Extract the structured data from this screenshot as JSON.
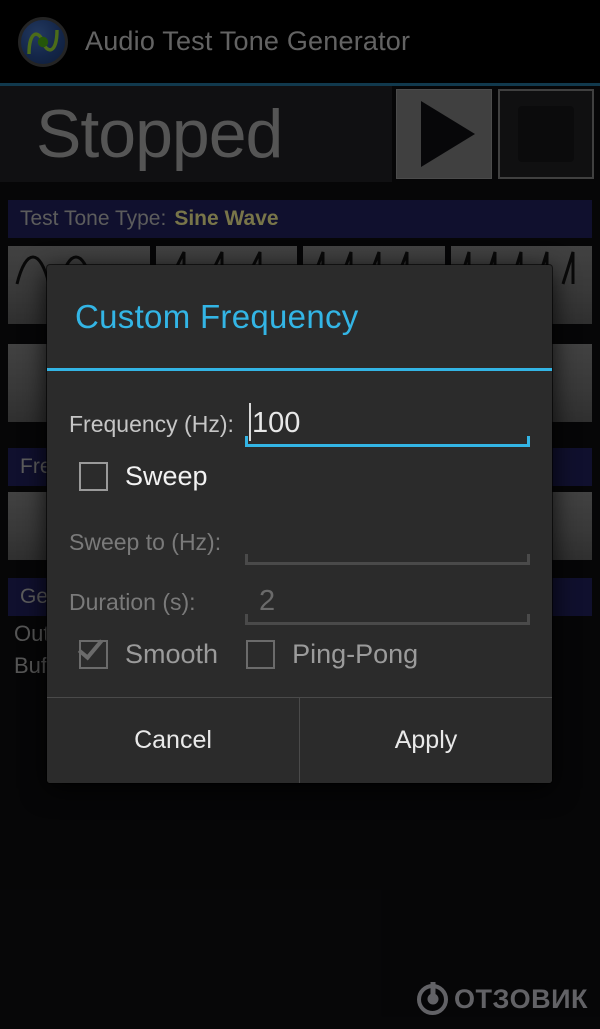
{
  "app": {
    "title": "Audio Test Tone Generator",
    "icon": "sine-wave-circle-icon",
    "accent_blue": "#33b5e5",
    "header_bar_blue": "#1c1c4e",
    "divider_blue": "#1d6080"
  },
  "transport": {
    "status": "Stopped",
    "play_icon": "play-icon",
    "stop_icon": "stop-icon"
  },
  "sections": {
    "tone_type": {
      "label": "Test Tone Type:",
      "value": "Sine Wave"
    },
    "frequency": {
      "label": "Frequency",
      "value": ""
    },
    "general": {
      "label": "General",
      "value": ""
    }
  },
  "general_text": "Output\nBuffer",
  "dialog": {
    "title": "Custom Frequency",
    "fields": [
      {
        "label": "Frequency (Hz):",
        "value": "100",
        "placeholder": "",
        "enabled": true,
        "focused": true
      },
      {
        "label": "Sweep to (Hz):",
        "value": "",
        "placeholder": "",
        "enabled": false,
        "focused": false
      },
      {
        "label": "Duration (s):",
        "value": "",
        "placeholder": "2",
        "enabled": false,
        "focused": false
      }
    ],
    "sweep_checkbox": {
      "label": "Sweep",
      "checked": false,
      "enabled": true
    },
    "smooth_checkbox": {
      "label": "Smooth",
      "checked": true,
      "enabled": false
    },
    "pingpong_checkbox": {
      "label": "Ping-Pong",
      "checked": false,
      "enabled": false
    },
    "cancel_label": "Cancel",
    "apply_label": "Apply"
  },
  "watermark": {
    "text": "ОТЗОВИК",
    "icon": "otzovik-logo-icon"
  }
}
